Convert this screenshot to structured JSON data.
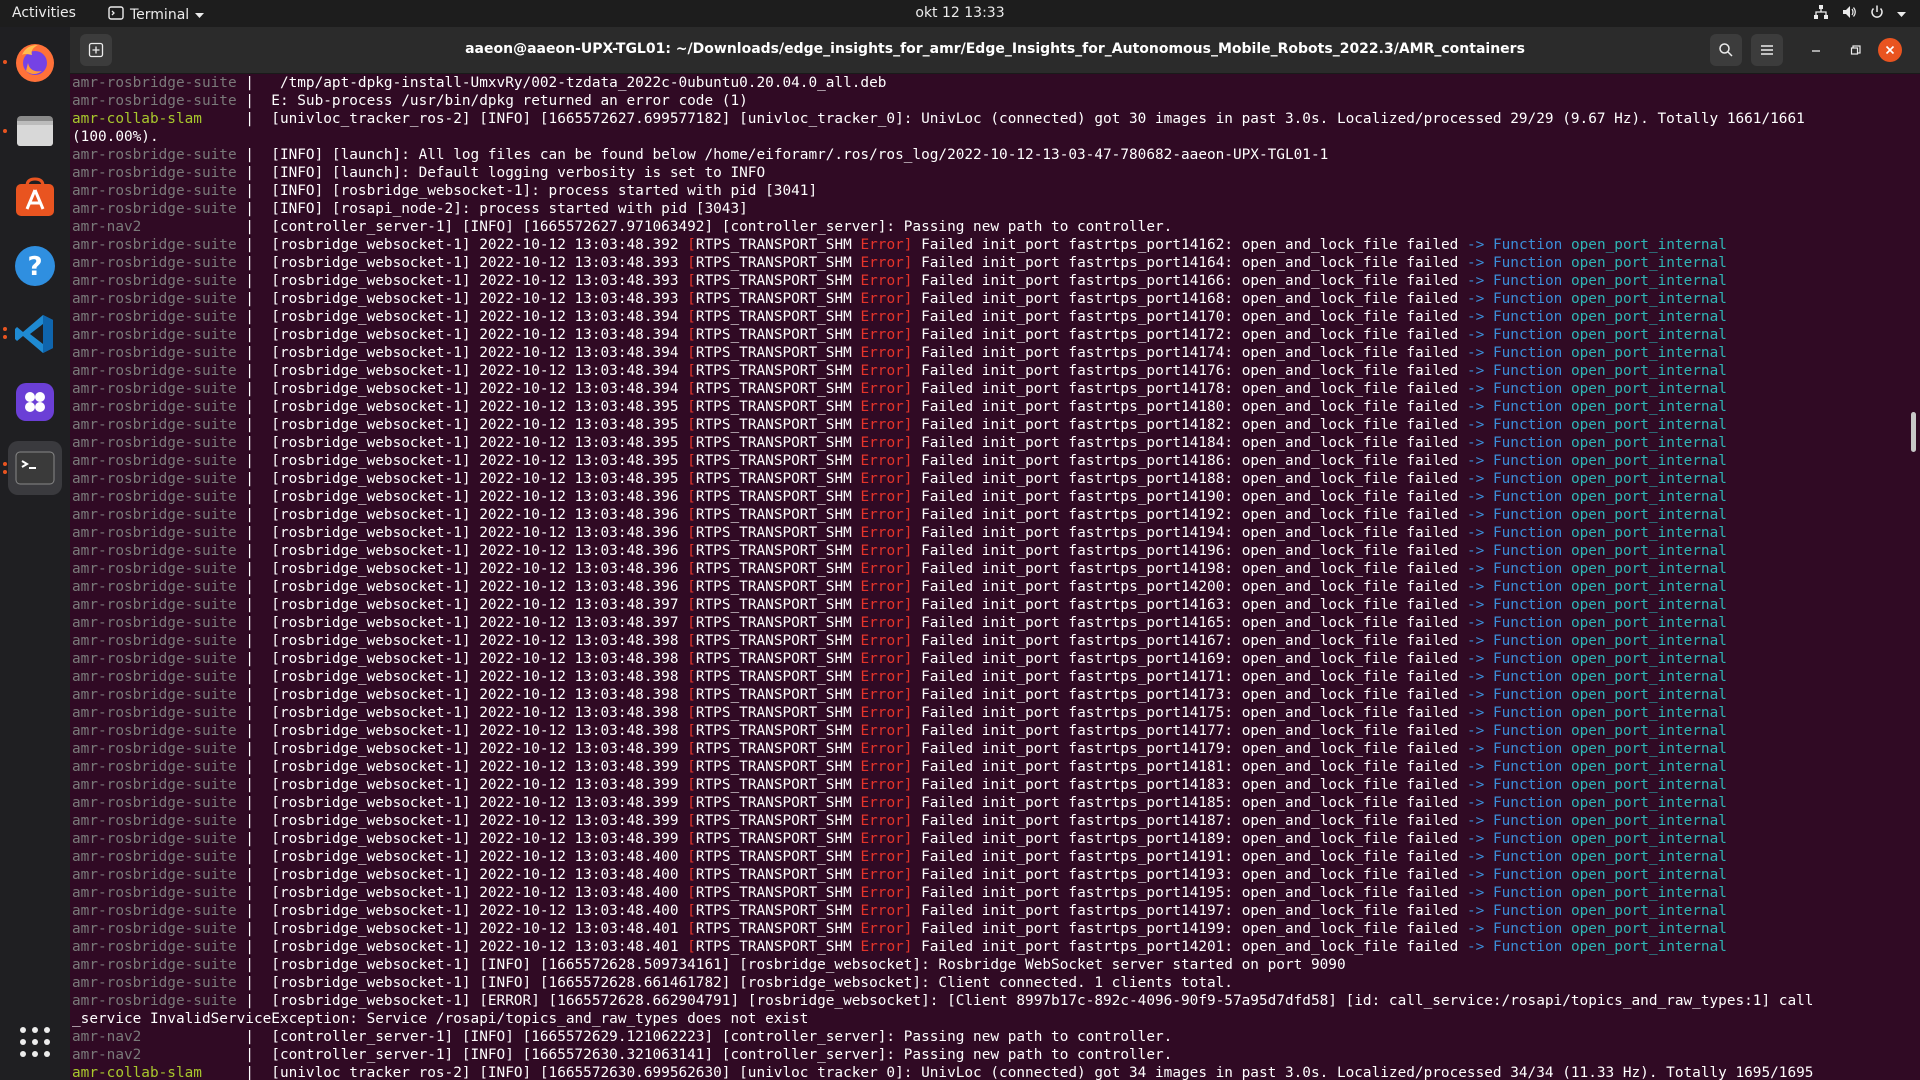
{
  "topbar": {
    "activities": "Activities",
    "app_name": "Terminal",
    "clock": "okt 12  13:33"
  },
  "dock": {
    "items": [
      "firefox-icon",
      "files-icon",
      "software-icon",
      "help-icon",
      "vscode-icon",
      "slack-icon",
      "terminal-icon"
    ],
    "show_apps": "show-apps-icon"
  },
  "window": {
    "title": "aaeon@aaeon-UPX-TGL01: ~/Downloads/edge_insights_for_amr/Edge_Insights_for_Autonomous_Mobile_Robots_2022.3/AMR_containers"
  },
  "colors": {
    "terminal_bg": "#300a24",
    "error": "#e5342a",
    "function_kw": "#3b8ed8",
    "function_name": "#2fb5b5",
    "slam_service": "#a8c72d",
    "service": "#7a7a7a"
  },
  "terminal": {
    "lines": [
      {
        "svc": "amr-rosbridge-suite",
        "text": " /tmp/apt-dpkg-install-UmxvRy/002-tzdata_2022c-0ubuntu0.20.04.0_all.deb"
      },
      {
        "svc": "amr-rosbridge-suite",
        "text": "E: Sub-process /usr/bin/dpkg returned an error code (1)"
      },
      {
        "svc": "amr-collab-slam",
        "text": "[univloc_tracker_ros-2] [INFO] [1665572627.699577182] [univloc_tracker_0]: UnivLoc (connected) got 30 images in past 3.0s. Localized/processed 29/29 (9.67 Hz). Totally 1661/1661"
      },
      {
        "svc": "",
        "text": "(100.00%)."
      },
      {
        "svc": "amr-rosbridge-suite",
        "text": "[INFO] [launch]: All log files can be found below /home/eiforamr/.ros/ros_log/2022-10-12-13-03-47-780682-aaeon-UPX-TGL01-1"
      },
      {
        "svc": "amr-rosbridge-suite",
        "text": "[INFO] [launch]: Default logging verbosity is set to INFO"
      },
      {
        "svc": "amr-rosbridge-suite",
        "text": "[INFO] [rosbridge_websocket-1]: process started with pid [3041]"
      },
      {
        "svc": "amr-rosbridge-suite",
        "text": "[INFO] [rosapi_node-2]: process started with pid [3043]"
      },
      {
        "svc": "amr-nav2",
        "text": "[controller_server-1] [INFO] [1665572627.971063492] [controller_server]: Passing new path to controller."
      },
      {
        "svc": "amr-rosbridge-suite",
        "ts": "48.392",
        "port": "14162"
      },
      {
        "svc": "amr-rosbridge-suite",
        "ts": "48.393",
        "port": "14164"
      },
      {
        "svc": "amr-rosbridge-suite",
        "ts": "48.393",
        "port": "14166"
      },
      {
        "svc": "amr-rosbridge-suite",
        "ts": "48.393",
        "port": "14168"
      },
      {
        "svc": "amr-rosbridge-suite",
        "ts": "48.394",
        "port": "14170"
      },
      {
        "svc": "amr-rosbridge-suite",
        "ts": "48.394",
        "port": "14172"
      },
      {
        "svc": "amr-rosbridge-suite",
        "ts": "48.394",
        "port": "14174"
      },
      {
        "svc": "amr-rosbridge-suite",
        "ts": "48.394",
        "port": "14176"
      },
      {
        "svc": "amr-rosbridge-suite",
        "ts": "48.394",
        "port": "14178"
      },
      {
        "svc": "amr-rosbridge-suite",
        "ts": "48.395",
        "port": "14180"
      },
      {
        "svc": "amr-rosbridge-suite",
        "ts": "48.395",
        "port": "14182"
      },
      {
        "svc": "amr-rosbridge-suite",
        "ts": "48.395",
        "port": "14184"
      },
      {
        "svc": "amr-rosbridge-suite",
        "ts": "48.395",
        "port": "14186"
      },
      {
        "svc": "amr-rosbridge-suite",
        "ts": "48.395",
        "port": "14188"
      },
      {
        "svc": "amr-rosbridge-suite",
        "ts": "48.396",
        "port": "14190"
      },
      {
        "svc": "amr-rosbridge-suite",
        "ts": "48.396",
        "port": "14192"
      },
      {
        "svc": "amr-rosbridge-suite",
        "ts": "48.396",
        "port": "14194"
      },
      {
        "svc": "amr-rosbridge-suite",
        "ts": "48.396",
        "port": "14196"
      },
      {
        "svc": "amr-rosbridge-suite",
        "ts": "48.396",
        "port": "14198"
      },
      {
        "svc": "amr-rosbridge-suite",
        "ts": "48.396",
        "port": "14200"
      },
      {
        "svc": "amr-rosbridge-suite",
        "ts": "48.397",
        "port": "14163"
      },
      {
        "svc": "amr-rosbridge-suite",
        "ts": "48.397",
        "port": "14165"
      },
      {
        "svc": "amr-rosbridge-suite",
        "ts": "48.398",
        "port": "14167"
      },
      {
        "svc": "amr-rosbridge-suite",
        "ts": "48.398",
        "port": "14169"
      },
      {
        "svc": "amr-rosbridge-suite",
        "ts": "48.398",
        "port": "14171"
      },
      {
        "svc": "amr-rosbridge-suite",
        "ts": "48.398",
        "port": "14173"
      },
      {
        "svc": "amr-rosbridge-suite",
        "ts": "48.398",
        "port": "14175"
      },
      {
        "svc": "amr-rosbridge-suite",
        "ts": "48.398",
        "port": "14177"
      },
      {
        "svc": "amr-rosbridge-suite",
        "ts": "48.399",
        "port": "14179"
      },
      {
        "svc": "amr-rosbridge-suite",
        "ts": "48.399",
        "port": "14181"
      },
      {
        "svc": "amr-rosbridge-suite",
        "ts": "48.399",
        "port": "14183"
      },
      {
        "svc": "amr-rosbridge-suite",
        "ts": "48.399",
        "port": "14185"
      },
      {
        "svc": "amr-rosbridge-suite",
        "ts": "48.399",
        "port": "14187"
      },
      {
        "svc": "amr-rosbridge-suite",
        "ts": "48.399",
        "port": "14189"
      },
      {
        "svc": "amr-rosbridge-suite",
        "ts": "48.400",
        "port": "14191"
      },
      {
        "svc": "amr-rosbridge-suite",
        "ts": "48.400",
        "port": "14193"
      },
      {
        "svc": "amr-rosbridge-suite",
        "ts": "48.400",
        "port": "14195"
      },
      {
        "svc": "amr-rosbridge-suite",
        "ts": "48.400",
        "port": "14197"
      },
      {
        "svc": "amr-rosbridge-suite",
        "ts": "48.401",
        "port": "14199"
      },
      {
        "svc": "amr-rosbridge-suite",
        "ts": "48.401",
        "port": "14201"
      },
      {
        "svc": "amr-rosbridge-suite",
        "text": "[rosbridge_websocket-1] [INFO] [1665572628.509734161] [rosbridge_websocket]: Rosbridge WebSocket server started on port 9090"
      },
      {
        "svc": "amr-rosbridge-suite",
        "text": "[rosbridge_websocket-1] [INFO] [1665572628.661461782] [rosbridge_websocket]: Client connected. 1 clients total."
      },
      {
        "svc": "amr-rosbridge-suite",
        "text": "[rosbridge_websocket-1] [ERROR] [1665572628.662904791] [rosbridge_websocket]: [Client 8997b17c-892c-4096-90f9-57a95d7dfd58] [id: call_service:/rosapi/topics_and_raw_types:1] call"
      },
      {
        "raw": "_service InvalidServiceException: Service /rosapi/topics_and_raw_types does not exist"
      },
      {
        "svc": "amr-nav2",
        "text": "[controller_server-1] [INFO] [1665572629.121062223] [controller_server]: Passing new path to controller."
      },
      {
        "svc": "amr-nav2",
        "text": "[controller_server-1] [INFO] [1665572630.321063141] [controller_server]: Passing new path to controller."
      },
      {
        "svc": "amr-collab-slam",
        "text": "[univloc_tracker_ros-2] [INFO] [1665572630.699562630] [univloc_tracker_0]: UnivLoc (connected) got 34 images in past 3.0s. Localized/processed 34/34 (11.33 Hz). Totally 1695/1695"
      }
    ],
    "shm_template": {
      "node": "[rosbridge_websocket-1]",
      "date": "2022-10-12 13:03:",
      "tag_open": "[",
      "tag": "RTPS_TRANSPORT_SHM",
      "level": "Error",
      "tag_close": "]",
      "msg_prefix": "Failed init_port fastrtps_port",
      "msg_suffix": ": open_and_lock_file failed",
      "arrow": "->",
      "fn_kw": "Function",
      "fn_name": "open_port_internal"
    }
  }
}
